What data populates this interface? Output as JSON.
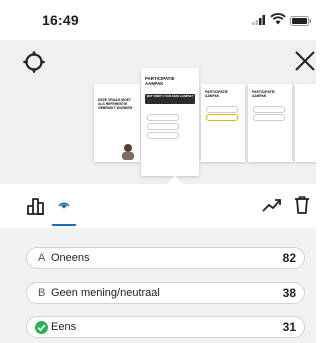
{
  "status_bar": {
    "time": "16:49"
  },
  "slides": [
    {
      "kicker": "",
      "title": "DEZE VRAAG MOET ALS REFERENTIE GEBRUIKT WORDEN"
    },
    {
      "kicker": "",
      "title": "PARTICIPATIE AANPAK",
      "bar_text": "WAT VINDT U VAN DEZE AANPAK?"
    },
    {
      "kicker": "",
      "title": "PARTICIPATIE AANPAK"
    },
    {
      "kicker": "",
      "title": "PARTICIPATIE AANPAK"
    }
  ],
  "results": [
    {
      "letter": "A",
      "label": "Oneens",
      "count": "82",
      "correct": false
    },
    {
      "letter": "B",
      "label": "Geen mening/neutraal",
      "count": "38",
      "correct": false
    },
    {
      "letter": "",
      "label": "Eens",
      "count": "31",
      "correct": true
    }
  ],
  "colors": {
    "accent_blue": "#1a6fb5",
    "check_green": "#2bb24c",
    "highlight_yellow": "#e4b800"
  },
  "icons": {
    "settings": "gear-icon",
    "close": "close-icon",
    "chart": "bar-chart-icon",
    "live": "broadcast-icon",
    "trend": "trending-up-icon",
    "delete": "trash-icon"
  }
}
